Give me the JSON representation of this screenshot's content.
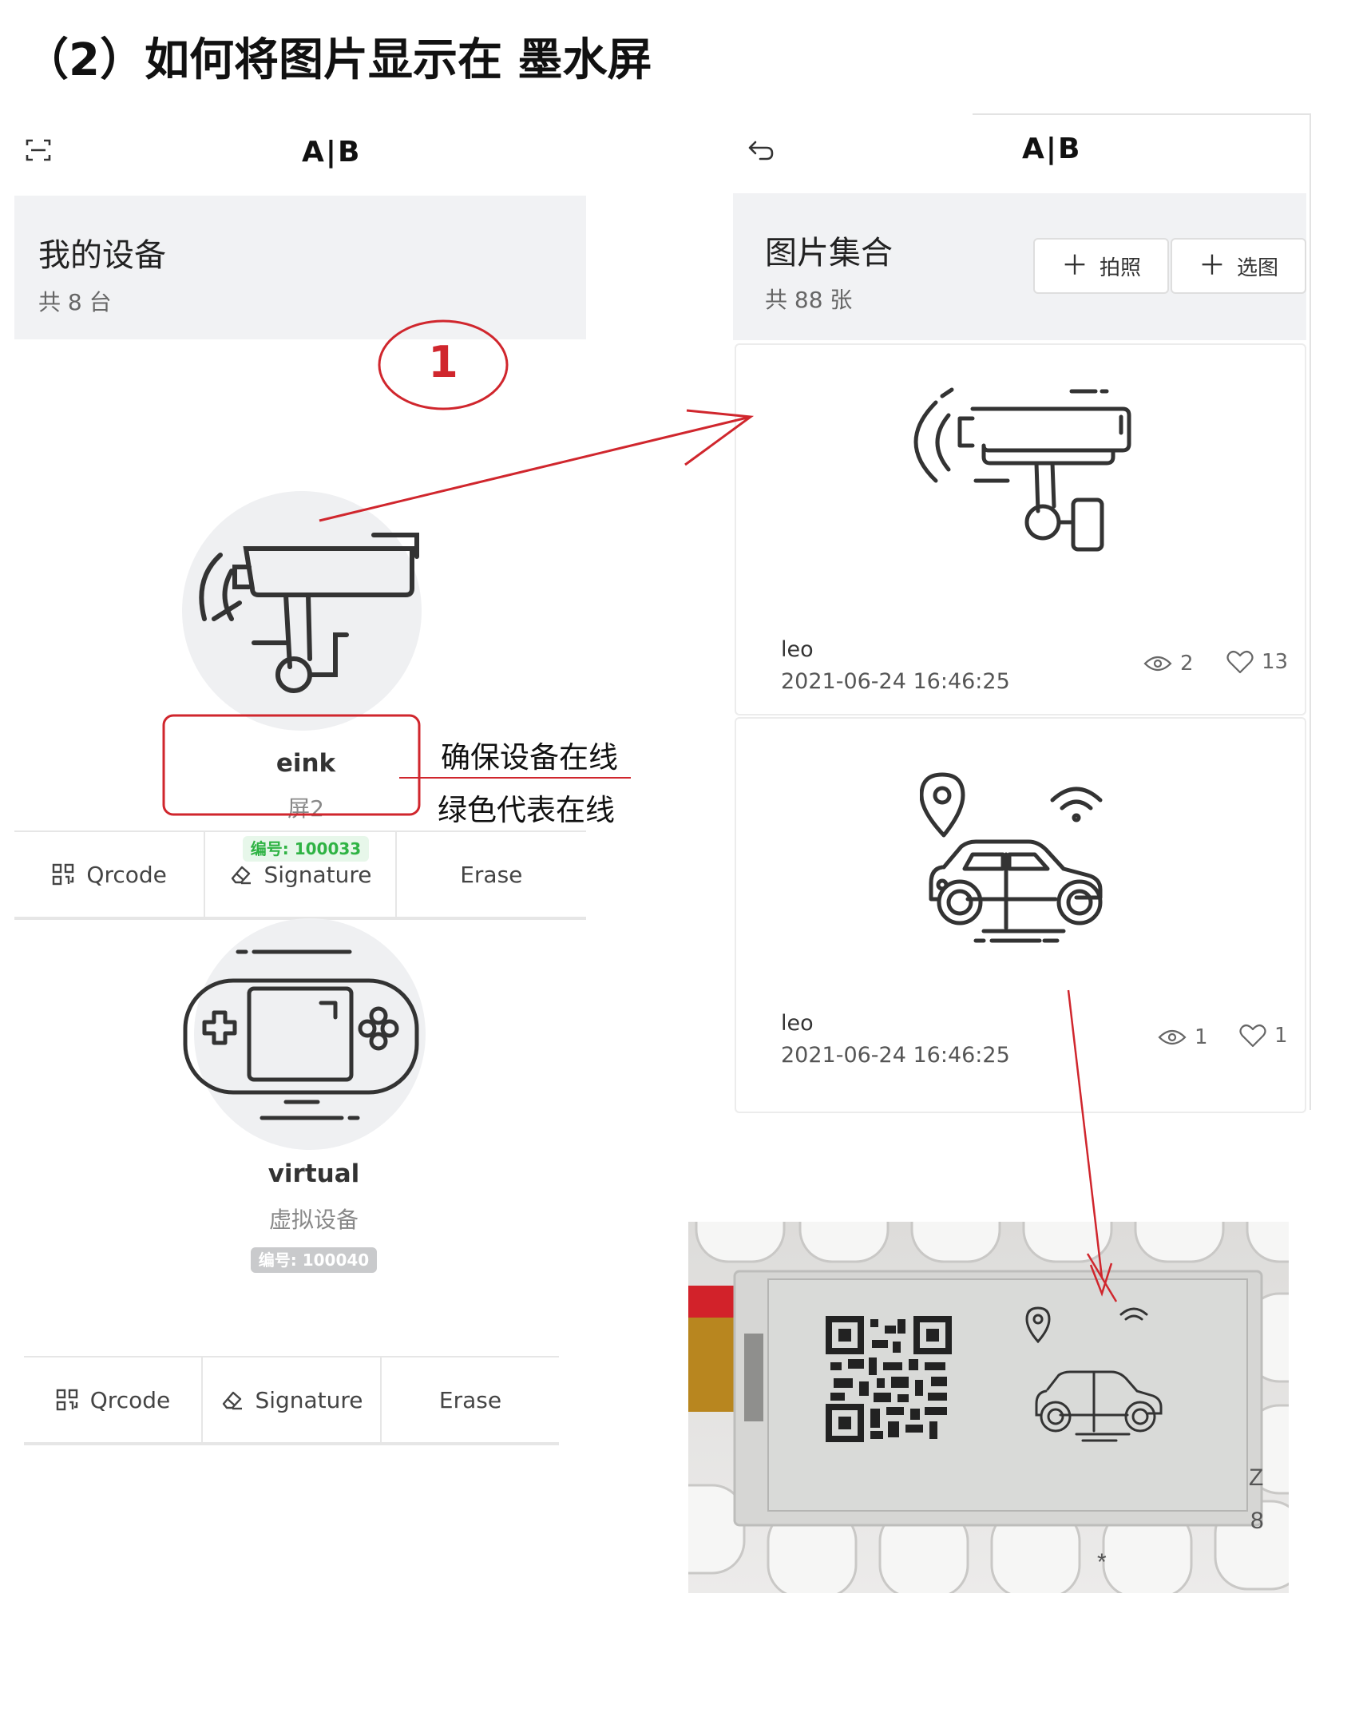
{
  "doc_title": "（2）如何将图片显示在 墨水屏",
  "left": {
    "logo": "A|B",
    "section_title": "我的设备",
    "section_count": "共 8 台",
    "devices": [
      {
        "name": "eink",
        "sub": "屏2",
        "badge": "编号: 100033",
        "badge_status": "online",
        "icon": "security-camera-icon"
      },
      {
        "name": "virtual",
        "sub": "虚拟设备",
        "badge": "编号: 100040",
        "badge_status": "offline",
        "icon": "game-console-icon"
      }
    ],
    "actions": [
      "Qrcode",
      "Signature",
      "Erase"
    ]
  },
  "right": {
    "logo": "A|B",
    "section_title": "图片集合",
    "section_count": "共 88 张",
    "btn_photo": "拍照",
    "btn_pick": "选图",
    "cards": [
      {
        "user": "leo",
        "time": "2021-06-24 16:46:25",
        "views": "2",
        "likes": "13",
        "icon": "security-camera-icon"
      },
      {
        "user": "leo",
        "time": "2021-06-24 16:46:25",
        "views": "1",
        "likes": "1",
        "icon": "smart-car-icon"
      }
    ]
  },
  "annotations": {
    "step": "1",
    "note1": "确保设备在线",
    "note2": "绿色代表在线",
    "colors": {
      "annotation_red": "#d0262d",
      "online_green": "#2fb344"
    }
  }
}
